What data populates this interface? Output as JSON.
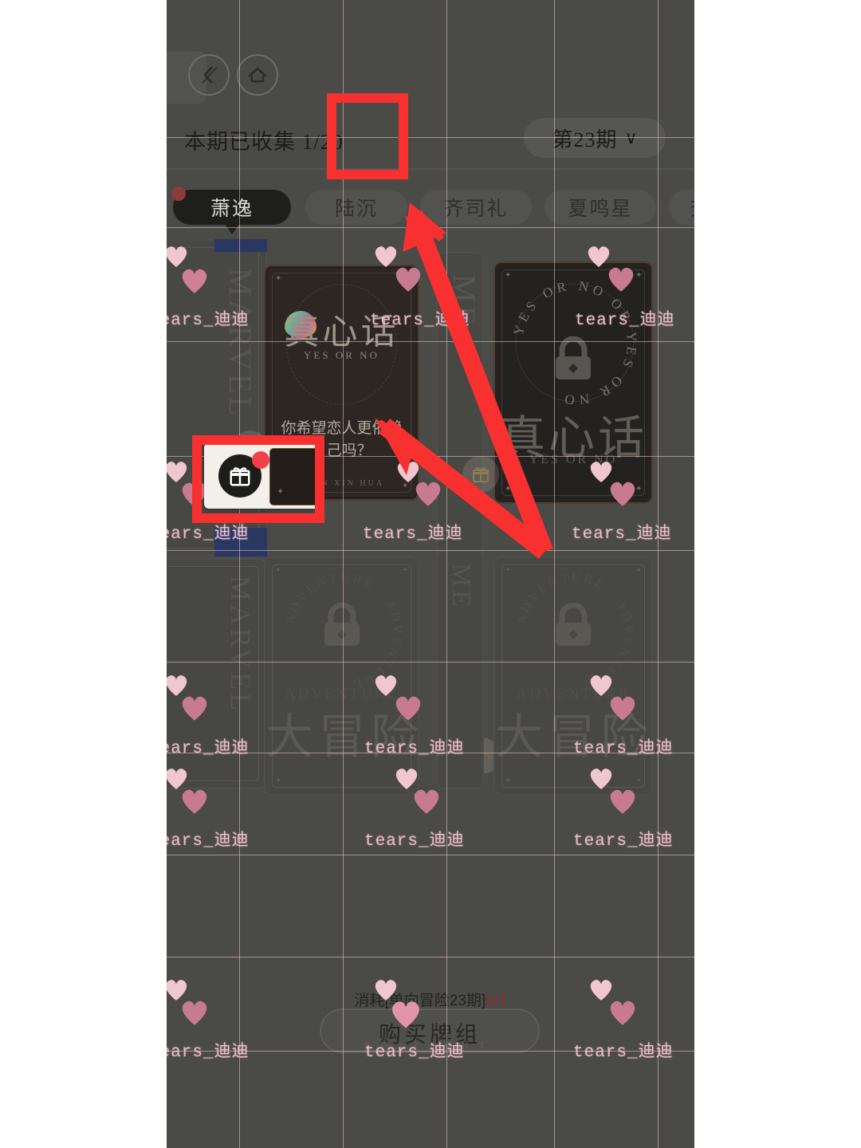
{
  "app": {
    "nav": {
      "back_icon": "back-arrow-icon",
      "home_icon": "home-icon"
    },
    "header": {
      "collected_label": "本期已收集 1/20",
      "period_value": "第23期",
      "period_chevron": "∨"
    },
    "tabs": [
      {
        "label": "萧逸",
        "active": true,
        "badge": true
      },
      {
        "label": "陆沉",
        "active": false,
        "badge": false
      },
      {
        "label": "齐司礼",
        "active": false,
        "badge": false
      },
      {
        "label": "夏鸣星",
        "active": false,
        "badge": false
      },
      {
        "label": "查",
        "active": false,
        "badge": false
      }
    ],
    "cards": [
      {
        "type": "truth",
        "title": "真心话",
        "subtitle": "YES OR NO",
        "question": "你希望恋人更依赖自己吗？",
        "footer": "ZHEN XIN HUA",
        "locked": false
      },
      {
        "type": "truth-locked",
        "title": "真心话",
        "subtitle": "YES OR NO",
        "ring_text": "YES OR NO OR YES",
        "lock_icon": "lock-icon",
        "locked": true
      },
      {
        "type": "adventure-locked",
        "title": "大冒险",
        "subtitle": "ADVENTURE",
        "ring_text": "ADVENTURE · ADVENTURE",
        "lock_icon": "lock-icon",
        "locked": true
      },
      {
        "type": "adventure-locked",
        "title": "大冒险",
        "subtitle": "ADVENTURE",
        "ring_text": "ADVENTURE · ADVENTURE",
        "lock_icon": "lock-icon",
        "locked": true
      }
    ],
    "side_labels": {
      "left_vertical": "MARVEL",
      "mid_vertical": "ME"
    },
    "purchase": {
      "cost_prefix": "消耗",
      "cost_item": "[单向冒险23期]",
      "cost_count": "0/1",
      "button_label": "购买牌组",
      "button_sub": "TWILIGHT"
    },
    "gift_popup": {
      "icon": "gift-icon",
      "badge": "red-dot-badge"
    },
    "gift_chip_icon": "gift-icon"
  },
  "annotations": {
    "boxes": [
      {
        "name": "gift-entry-highlight"
      },
      {
        "name": "gift-popup-highlight"
      }
    ],
    "arrows": [
      {
        "name": "arrow-to-gift-entry"
      },
      {
        "name": "arrow-to-gift-popup"
      }
    ],
    "color": "#f8302f"
  },
  "watermark": {
    "text": "tears_迪迪",
    "color": "#f3b9c9"
  },
  "colors": {
    "background": "#4a4a47",
    "accent_red": "#f8302f",
    "tab_active_bg": "#1e1e1c",
    "heart_pink": "#e07f99"
  }
}
